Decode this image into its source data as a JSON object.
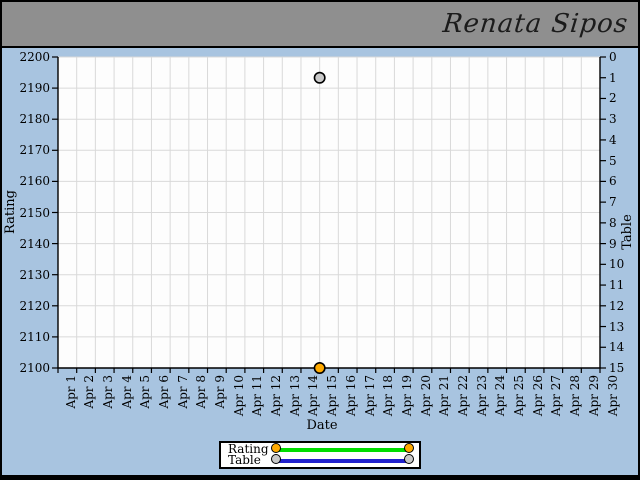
{
  "header": {
    "title": "Renata Sipos"
  },
  "colors": {
    "header_bg": "#8f8f8f",
    "canvas_bg": "#a8c4e0",
    "plot_bg": "#fdfdfd",
    "grid": "#d9d9d9",
    "axis": "#000000",
    "legend_bg": "#ffffff",
    "rating_marker": "#ffaa00",
    "rating_line": "#00dd00",
    "table_marker": "#c9c9c9",
    "table_line": "#2121cd"
  },
  "chart_data": {
    "type": "scatter",
    "title": "Renata Sipos",
    "xlabel": "Date",
    "ylabel_left": "Rating",
    "ylabel_right": "Table",
    "grid": true,
    "legend_position": "bottom-center",
    "x_categories": [
      "Apr 1",
      "Apr 2",
      "Apr 3",
      "Apr 4",
      "Apr 5",
      "Apr 6",
      "Apr 7",
      "Apr 8",
      "Apr 9",
      "Apr 10",
      "Apr 11",
      "Apr 12",
      "Apr 13",
      "Apr 14",
      "Apr 15",
      "Apr 16",
      "Apr 17",
      "Apr 18",
      "Apr 19",
      "Apr 20",
      "Apr 21",
      "Apr 22",
      "Apr 23",
      "Apr 24",
      "Apr 25",
      "Apr 26",
      "Apr 27",
      "Apr 28",
      "Apr 29",
      "Apr 30"
    ],
    "y_left_axis": {
      "label": "Rating",
      "min": 2100,
      "max": 2200,
      "step": 10,
      "ticks": [
        2100,
        2110,
        2120,
        2130,
        2140,
        2150,
        2160,
        2170,
        2180,
        2190,
        2200
      ]
    },
    "y_right_axis": {
      "label": "Table",
      "min": 0,
      "max": 15,
      "step": 1,
      "inverted": true,
      "ticks": [
        0,
        1,
        2,
        3,
        4,
        5,
        6,
        7,
        8,
        9,
        10,
        11,
        12,
        13,
        14,
        15
      ]
    },
    "series": [
      {
        "name": "Rating",
        "axis": "left",
        "marker_color": "#ffaa00",
        "line_color": "#00dd00",
        "points": [
          {
            "x": "Apr 15",
            "y": 2100
          }
        ]
      },
      {
        "name": "Table",
        "axis": "right",
        "marker_color": "#c9c9c9",
        "line_color": "#2121cd",
        "points": [
          {
            "x": "Apr 15",
            "y": 1
          }
        ]
      }
    ]
  }
}
